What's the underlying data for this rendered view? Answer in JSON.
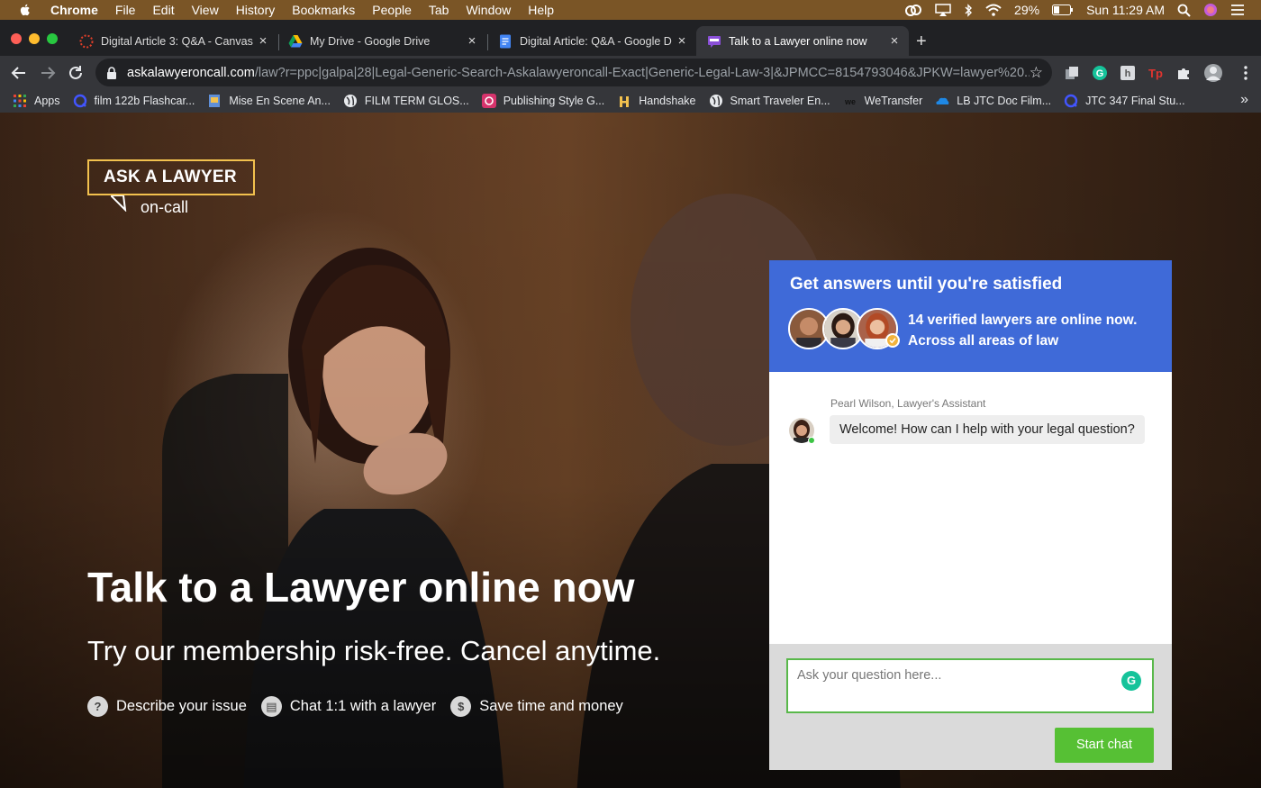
{
  "menubar": {
    "app": "Chrome",
    "items": [
      "File",
      "Edit",
      "View",
      "History",
      "Bookmarks",
      "People",
      "Tab",
      "Window",
      "Help"
    ],
    "battery": "29%",
    "clock": "Sun 11:29 AM"
  },
  "tabs": [
    {
      "title": "Digital Article 3: Q&A - Canvas",
      "icon": "canvas-icon",
      "close": "×"
    },
    {
      "title": "My Drive - Google Drive",
      "icon": "google-drive-icon",
      "close": "×"
    },
    {
      "title": "Digital Article: Q&A - Google D",
      "icon": "google-docs-icon",
      "close": "×"
    },
    {
      "title": "Talk to a Lawyer online now",
      "icon": "ask-lawyer-favicon",
      "close": "×",
      "active": true
    }
  ],
  "new_tab": "+",
  "address": {
    "host": "askalawyeroncall.com",
    "path": "/law?r=ppc|galpa|28|Legal-Generic-Search-Askalawyeroncall-Exact|Generic-Legal-Law-3|&JPMCC=8154793046&JPKW=lawyer%20..."
  },
  "bookmarks": [
    {
      "label": "Apps",
      "icon": "apps-grid-icon"
    },
    {
      "label": "film 122b Flashcar...",
      "icon": "quizlet-icon"
    },
    {
      "label": "Mise En Scene An...",
      "icon": "page-icon"
    },
    {
      "label": "FILM TERM GLOS...",
      "icon": "globe-icon"
    },
    {
      "label": "Publishing Style G...",
      "icon": "publishing-icon"
    },
    {
      "label": "Handshake",
      "icon": "handshake-icon"
    },
    {
      "label": "Smart Traveler En...",
      "icon": "globe-icon"
    },
    {
      "label": "WeTransfer",
      "icon": "wetransfer-icon"
    },
    {
      "label": "LB JTC Doc Film...",
      "icon": "onedrive-icon"
    },
    {
      "label": "JTC 347 Final Stu...",
      "icon": "quizlet-icon"
    }
  ],
  "bookmarks_more": "»",
  "colors": {
    "brand_gold": "#f2c14e",
    "chat_blue": "#3f6ad8",
    "start_green": "#56c034"
  },
  "page": {
    "logo": {
      "brand": "ASK A LAWYER",
      "sub": "on-call"
    },
    "title": "Talk to a Lawyer online now",
    "subtitle": "Try our membership risk-free. Cancel anytime.",
    "features": [
      {
        "icon": "question-icon",
        "glyph": "?",
        "label": "Describe your issue"
      },
      {
        "icon": "chat-icon",
        "glyph": "▤",
        "label": "Chat 1:1 with a lawyer"
      },
      {
        "icon": "dollar-icon",
        "glyph": "$",
        "label": "Save time and money"
      }
    ]
  },
  "chat": {
    "header": "Get answers until you're satisfied",
    "online_line1": "14 verified lawyers are online now.",
    "online_line2": "Across all areas of law",
    "assistant_name": "Pearl Wilson, Lawyer's Assistant",
    "message": "Welcome! How can I help with your legal question?",
    "input_placeholder": "Ask your question here...",
    "grammarly_glyph": "G",
    "start_button": "Start chat"
  }
}
